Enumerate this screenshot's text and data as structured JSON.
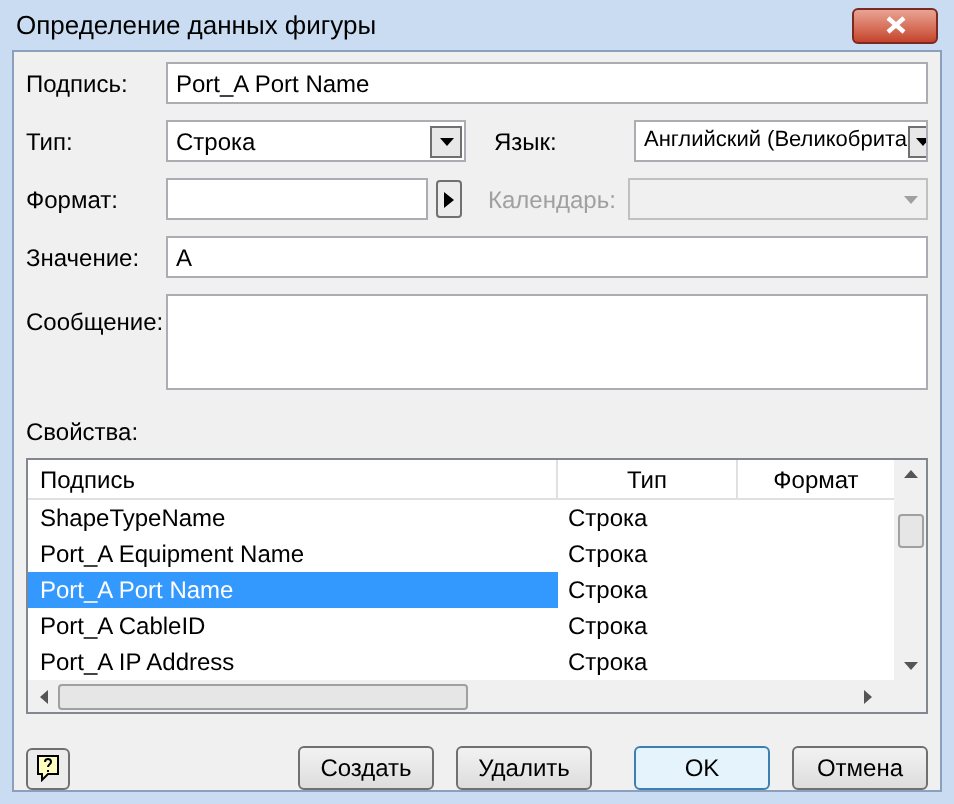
{
  "window": {
    "title": "Определение данных фигуры"
  },
  "fields": {
    "label": {
      "caption": "Подпись:",
      "value": "Port_A Port Name"
    },
    "type": {
      "caption": "Тип:",
      "value": "Строка"
    },
    "language": {
      "caption": "Язык:",
      "value": "Английский (Великобрита"
    },
    "format": {
      "caption": "Формат:"
    },
    "calendar": {
      "caption": "Календарь:",
      "disabled": true
    },
    "value": {
      "caption": "Значение:",
      "value": "A"
    },
    "message": {
      "caption": "Сообщение:"
    }
  },
  "properties": {
    "caption": "Свойства:",
    "columns": [
      "Подпись",
      "Тип",
      "Формат"
    ],
    "rows": [
      {
        "name": "ShapeTypeName",
        "type": "Строка",
        "selected": false
      },
      {
        "name": "Port_A Equipment Name",
        "type": "Строка",
        "selected": false
      },
      {
        "name": "Port_A Port Name",
        "type": "Строка",
        "selected": true
      },
      {
        "name": "Port_A CableID",
        "type": "Строка",
        "selected": false
      },
      {
        "name": "Port_A IP Address",
        "type": "Строка",
        "selected": false
      }
    ]
  },
  "buttons": [
    {
      "label": "Создать",
      "default": false
    },
    {
      "label": "Удалить",
      "default": false
    },
    {
      "label": "OK",
      "default": true
    },
    {
      "label": "Отмена",
      "default": false
    }
  ]
}
